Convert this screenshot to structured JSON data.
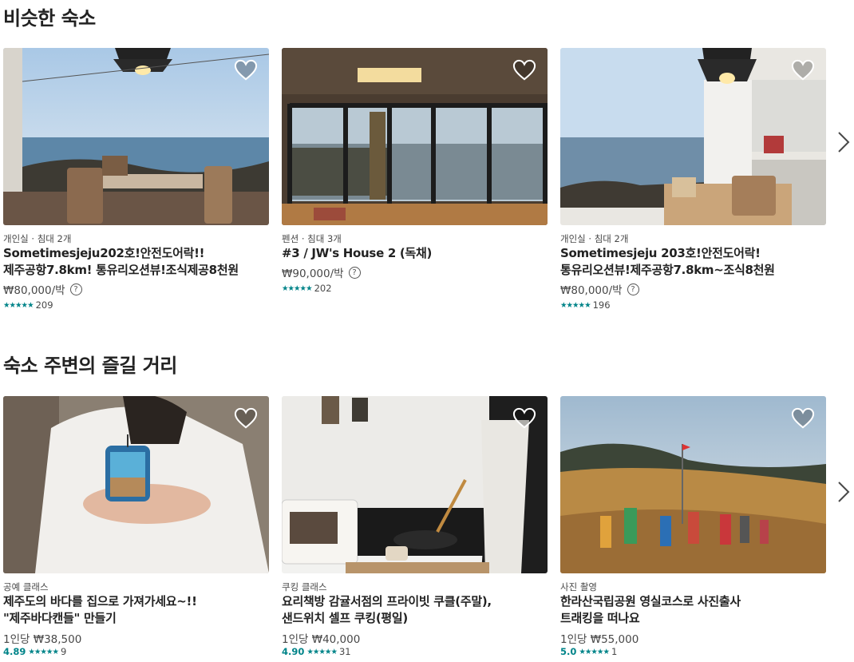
{
  "sections": [
    {
      "title": "비슷한 숙소",
      "cards": [
        {
          "meta": "개인실 · 침대 2개",
          "name1": "Sometimesjeju202호!안전도어락!!",
          "name2": "제주공항7.8km! 통유리오션뷰!조식제공8천원",
          "price": "₩80,000/박",
          "stars": "★★★★★",
          "reviews": "209"
        },
        {
          "meta": "펜션 · 침대 3개",
          "name1": "#3 / JW's House 2 (독채)",
          "name2": "",
          "price": "₩90,000/박",
          "stars": "★★★★★",
          "reviews": "202"
        },
        {
          "meta": "개인실 · 침대 2개",
          "name1": "Sometimesjeju 203호!안전도어락!",
          "name2": "통유리오션뷰!제주공항7.8km~조식8천원",
          "price": "₩80,000/박",
          "stars": "★★★★★",
          "reviews": "196"
        }
      ]
    },
    {
      "title": "숙소 주변의 즐길 거리",
      "cards": [
        {
          "meta": "공예 클래스",
          "name1": "제주도의 바다를 집으로 가져가세요~!!",
          "name2": "\"제주바다캔들\" 만들기",
          "price": "1인당 ₩38,500",
          "score": "4.89",
          "stars": "★★★★★",
          "reviews": "9"
        },
        {
          "meta": "쿠킹 클래스",
          "name1": "요리책방 감귤서점의 프라이빗 쿠클(주말),",
          "name2": "샌드위치 셀프 쿠킹(평일)",
          "price": "1인당 ₩40,000",
          "score": "4.90",
          "stars": "★★★★★",
          "reviews": "31"
        },
        {
          "meta": "사진 촬영",
          "name1": "한라산국립공원 영실코스로 사진출사",
          "name2": "트래킹을 떠나요",
          "price": "1인당 ₩55,000",
          "score": "5.0",
          "stars": "★★★★★",
          "reviews": "1"
        }
      ]
    }
  ],
  "price_help_symbol": "?",
  "icons": {
    "favorite": "heart-icon",
    "next": "chevron-right-icon",
    "help": "question-circle-icon"
  },
  "colors": {
    "accent": "#008489",
    "text": "#222222"
  }
}
